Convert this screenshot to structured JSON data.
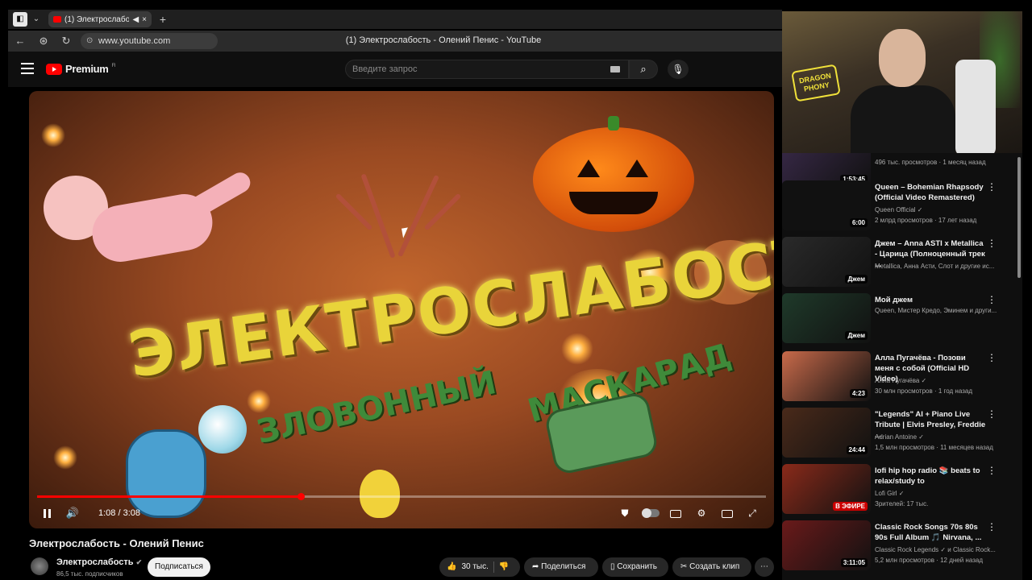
{
  "browser": {
    "tab_title": "(1) Электрослабость",
    "url": "www.youtube.com",
    "page_title": "(1) Электрослабость - Олений Пенис - YouTube"
  },
  "header": {
    "logo_text": "Premium",
    "logo_sup": "FI",
    "search_placeholder": "Введите запрос"
  },
  "player": {
    "artwork_title": "ЭЛЕКТРОСЛАБОСТЬ",
    "artwork_sub1": "ЗЛОВОННЫЙ",
    "artwork_sub2": "МАСКАРАД",
    "time": "1:08 / 3:08",
    "progress": 0.362,
    "accent": "#ff0000"
  },
  "video": {
    "title": "Электрослабость - Олений Пенис",
    "channel": "Электрослабость",
    "subscribers": "86,5 тыс. подписчиков",
    "subscribe_label": "Подписаться",
    "likes": "30 тыс.",
    "share_label": "Поделиться",
    "save_label": "Сохранить",
    "clip_label": "Создать клип"
  },
  "webcam": {
    "sign": "DRAGON PHONY"
  },
  "recommendations": [
    {
      "title": "",
      "channel": "",
      "meta": "496 тыс. просмотров · 1 месяц назад",
      "badge": "1:53:45",
      "thumb": "#3a2a4a"
    },
    {
      "title": "Queen – Bohemian Rhapsody (Official Video Remastered)",
      "channel": "Queen Official ✓",
      "meta": "2 млрд просмотров · 17 лет назад",
      "badge": "6:00",
      "thumb": "#111111"
    },
    {
      "title": "Джем – Anna ASTI x Metallica - Царица (Полноценный трек ...",
      "channel": "Metallica, Анна Асти, Слот и другие ис...",
      "meta": "",
      "badge": "Джем",
      "thumb": "#2a2a2a"
    },
    {
      "title": "Мой джем",
      "channel": "Queen, Мистер Кредо, Эминем и други...",
      "meta": "",
      "badge": "Джем",
      "thumb": "#1f3a2a"
    },
    {
      "title": "Алла Пугачёва - Позови меня с собой (Official HD Video)",
      "channel": "Алла Пугачёва ✓",
      "meta": "30 млн просмотров · 1 год назад",
      "badge": "4:23",
      "thumb": "#c86a4a"
    },
    {
      "title": "\"Legends\" AI + Piano Live Tribute | Elvis Presley, Freddie ...",
      "channel": "Adrian Antoine ✓",
      "meta": "1,5 млн просмотров · 11 месяцев назад",
      "badge": "24:44",
      "thumb": "#4a2a1a"
    },
    {
      "title": "lofi hip hop radio 📚 beats to relax/study to",
      "channel": "Lofi Girl ✓",
      "meta": "Зрителей: 17 тыс.",
      "badge": "В ЭФИРЕ",
      "thumb": "#8a2a1a"
    },
    {
      "title": "Classic Rock Songs 70s 80s 90s Full Album 🎵 Nirvana, ...",
      "channel": "Classic Rock Legends ✓ и Classic Rock...",
      "meta": "5,2 млн просмотров · 12 дней назад",
      "badge": "3:11:05",
      "thumb": "#6a1a1a"
    }
  ]
}
